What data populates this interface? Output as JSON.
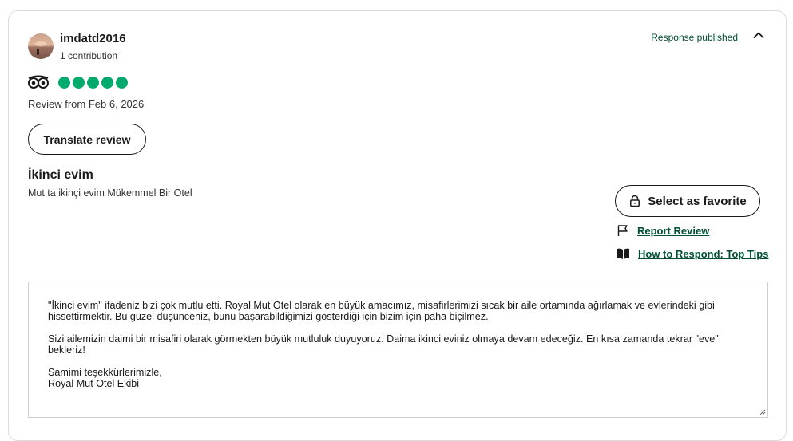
{
  "reviewer": {
    "username": "imdatd2016",
    "contributions": "1 contribution"
  },
  "status": {
    "label": "Response published"
  },
  "rating": {
    "value": 5,
    "max": 5,
    "color": "#00aa6c"
  },
  "review": {
    "date": "Review from Feb 6, 2026",
    "translate_label": "Translate review",
    "title": "İkinci evim",
    "text": "Mut ta ikinçi evim Mükemmel Bir Otel"
  },
  "actions": {
    "favorite_label": "Select as favorite",
    "report_label": "Report Review",
    "howto_label": "How to Respond: Top Tips"
  },
  "response": {
    "paragraph1": "\"İkinci evim\" ifadeniz bizi çok mutlu etti. Royal Mut Otel olarak en büyük amacımız, misafirlerimizi sıcak bir aile ortamında ağırlamak ve evlerindeki gibi hissettirmektir. Bu güzel düşünceniz, bunu başarabildiğimizi gösterdiği için bizim için paha biçilmez.",
    "paragraph2": "Sizi ailemizin daimi bir misafiri olarak görmekten büyük mutluluk duyuyoruz. Daima ikinci eviniz olmaya devam edeceğiz. En kısa zamanda tekrar \"eve\" bekleriz!",
    "signoff_line1": "Samimi teşekkürlerimizle,",
    "signoff_line2": "Royal Mut Otel Ekibi"
  },
  "colors": {
    "accent": "#004f32",
    "bubble": "#00aa6c"
  }
}
